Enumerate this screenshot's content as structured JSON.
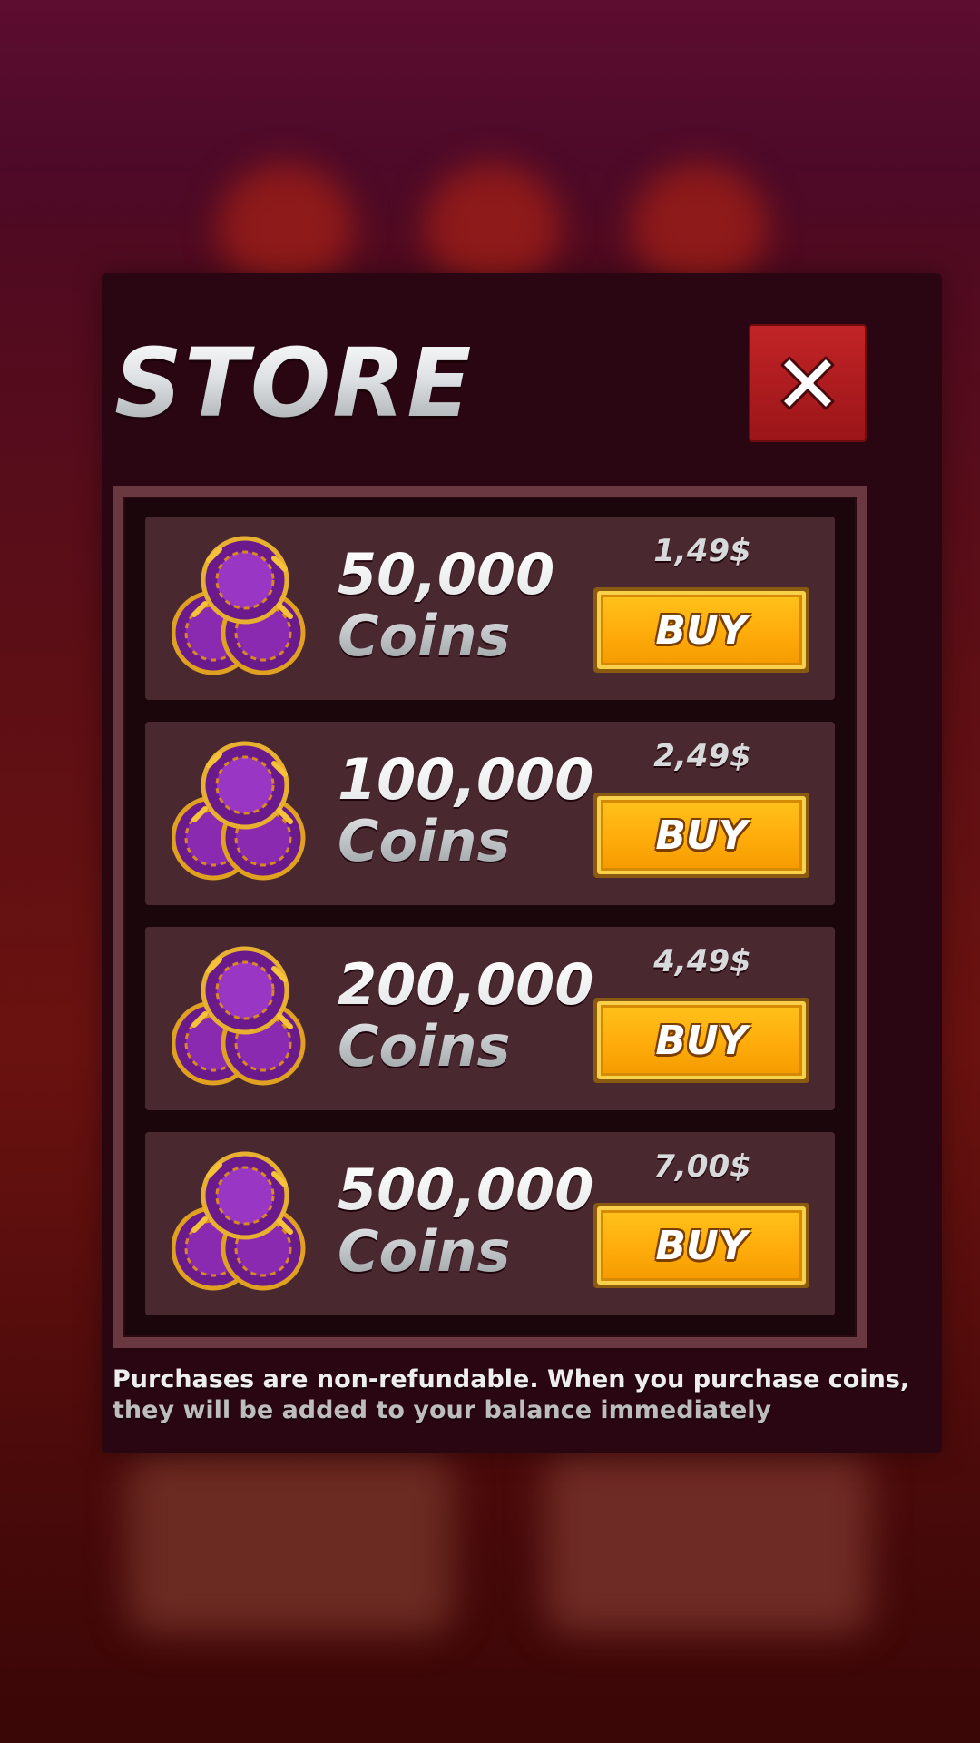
{
  "store": {
    "title": "STORE",
    "close_icon": "close-x-icon",
    "offers": [
      {
        "amount": "50,000",
        "unit": "Coins",
        "price": "1,49$",
        "buy_label": "BUY",
        "icon": "coin-chips-icon"
      },
      {
        "amount": "100,000",
        "unit": "Coins",
        "price": "2,49$",
        "buy_label": "BUY",
        "icon": "coin-chips-icon"
      },
      {
        "amount": "200,000",
        "unit": "Coins",
        "price": "4,49$",
        "buy_label": "BUY",
        "icon": "coin-chips-icon"
      },
      {
        "amount": "500,000",
        "unit": "Coins",
        "price": "7,00$",
        "buy_label": "BUY",
        "icon": "coin-chips-icon"
      }
    ],
    "disclaimer_line1": "Purchases are non-refundable. When you purchase coins,",
    "disclaimer_line2": "they will be added to your balance immediately"
  },
  "colors": {
    "modal_bg": "#2a0612",
    "close_red": "#c22426",
    "buy_orange": "#ffae0c",
    "offer_bg": "#4a2830"
  }
}
